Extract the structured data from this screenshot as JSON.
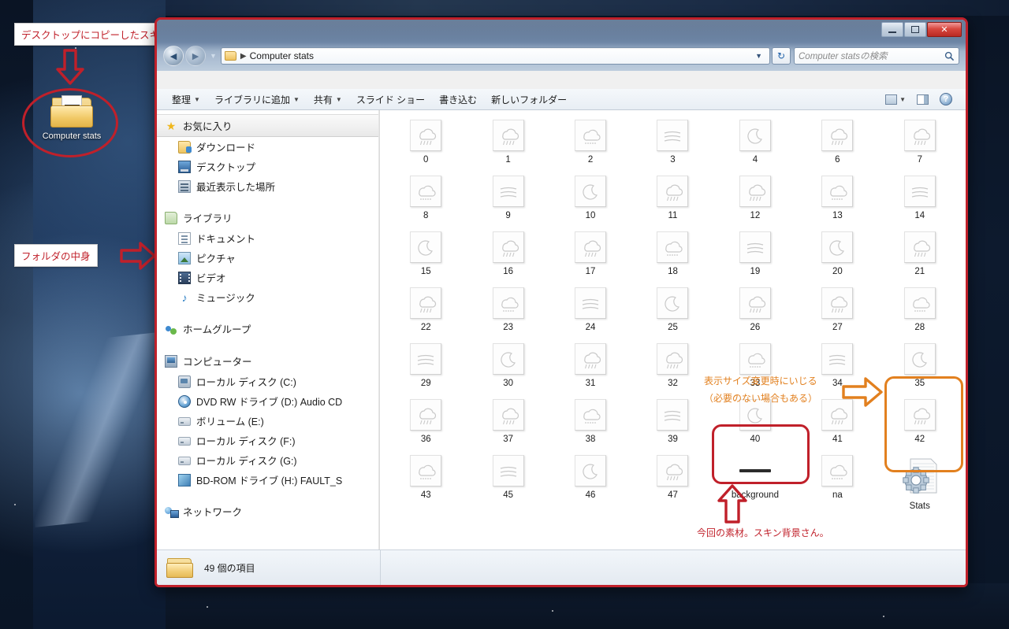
{
  "desktop": {
    "icon_label": "Computer stats",
    "annotations": {
      "callout_top": "デスクトップにコピーしたスキンのフォルダ",
      "callout_left": "フォルダの中身",
      "orange_line1": "表示サイズ変更時にいじる",
      "orange_line2": "（必要のない場合もある）",
      "red_bottom": "今回の素材。スキン背景さん。"
    },
    "colors": {
      "red": "#c0202a",
      "orange": "#e2801f"
    }
  },
  "window": {
    "title_buttons": {
      "minimize": "minimize-button",
      "maximize": "maximize-button",
      "close": "✕"
    },
    "nav": {
      "back": "◄",
      "forward": "►",
      "history_caret": "▼",
      "breadcrumb_root": "",
      "breadcrumb_sep": "▶",
      "breadcrumb_text": "Computer stats",
      "address_caret": "▼",
      "refresh": "↻"
    },
    "search": {
      "placeholder": "Computer statsの検索",
      "icon": "search-icon"
    },
    "toolbar": {
      "items": [
        {
          "label": "整理",
          "caret": "▼"
        },
        {
          "label": "ライブラリに追加",
          "caret": "▼"
        },
        {
          "label": "共有",
          "caret": "▼"
        },
        {
          "label": "スライド ショー",
          "caret": ""
        },
        {
          "label": "書き込む",
          "caret": ""
        },
        {
          "label": "新しいフォルダー",
          "caret": ""
        }
      ],
      "view_caret": "▼",
      "help_glyph": "?"
    }
  },
  "navpane": {
    "sections": [
      {
        "header": {
          "label": "お気に入り",
          "icon": "star-icon",
          "selected": true
        },
        "children": [
          {
            "label": "ダウンロード",
            "icon": "downloads-icon"
          },
          {
            "label": "デスクトップ",
            "icon": "desktop-icon"
          },
          {
            "label": "最近表示した場所",
            "icon": "recent-places-icon"
          }
        ]
      },
      {
        "header": {
          "label": "ライブラリ",
          "icon": "library-icon",
          "selected": false
        },
        "children": [
          {
            "label": "ドキュメント",
            "icon": "documents-icon"
          },
          {
            "label": "ピクチャ",
            "icon": "pictures-icon"
          },
          {
            "label": "ビデオ",
            "icon": "videos-icon"
          },
          {
            "label": "ミュージック",
            "icon": "music-icon"
          }
        ]
      },
      {
        "header": {
          "label": "ホームグループ",
          "icon": "homegroup-icon",
          "selected": false
        },
        "children": []
      },
      {
        "header": {
          "label": "コンピューター",
          "icon": "computer-icon",
          "selected": false
        },
        "children": [
          {
            "label": "ローカル ディスク (C:)",
            "icon": "local-disk-icon"
          },
          {
            "label": "DVD RW ドライブ (D:) Audio CD",
            "icon": "dvd-drive-icon"
          },
          {
            "label": "ボリューム (E:)",
            "icon": "drive-icon"
          },
          {
            "label": "ローカル ディスク (F:)",
            "icon": "drive-icon"
          },
          {
            "label": "ローカル ディスク (G:)",
            "icon": "drive-icon"
          },
          {
            "label": "BD-ROM ドライブ (H:) FAULT_S",
            "icon": "bd-rom-icon"
          }
        ]
      },
      {
        "header": {
          "label": "ネットワーク",
          "icon": "network-icon",
          "selected": false
        },
        "children": []
      }
    ]
  },
  "files": {
    "items": [
      {
        "label": "0",
        "icon": "weather-thumb"
      },
      {
        "label": "1",
        "icon": "weather-thumb"
      },
      {
        "label": "2",
        "icon": "weather-thumb"
      },
      {
        "label": "3",
        "icon": "weather-thumb"
      },
      {
        "label": "4",
        "icon": "weather-thumb"
      },
      {
        "label": "6",
        "icon": "weather-thumb"
      },
      {
        "label": "7",
        "icon": "weather-thumb"
      },
      {
        "label": "8",
        "icon": "weather-thumb"
      },
      {
        "label": "9",
        "icon": "weather-thumb"
      },
      {
        "label": "10",
        "icon": "weather-thumb"
      },
      {
        "label": "11",
        "icon": "weather-thumb"
      },
      {
        "label": "12",
        "icon": "weather-thumb"
      },
      {
        "label": "13",
        "icon": "weather-thumb"
      },
      {
        "label": "14",
        "icon": "weather-thumb"
      },
      {
        "label": "15",
        "icon": "weather-thumb"
      },
      {
        "label": "16",
        "icon": "weather-thumb"
      },
      {
        "label": "17",
        "icon": "weather-thumb"
      },
      {
        "label": "18",
        "icon": "weather-thumb"
      },
      {
        "label": "19",
        "icon": "weather-thumb"
      },
      {
        "label": "20",
        "icon": "weather-thumb"
      },
      {
        "label": "21",
        "icon": "weather-thumb"
      },
      {
        "label": "22",
        "icon": "weather-thumb"
      },
      {
        "label": "23",
        "icon": "weather-thumb"
      },
      {
        "label": "24",
        "icon": "weather-thumb"
      },
      {
        "label": "25",
        "icon": "weather-thumb"
      },
      {
        "label": "26",
        "icon": "weather-thumb"
      },
      {
        "label": "27",
        "icon": "weather-thumb"
      },
      {
        "label": "28",
        "icon": "weather-thumb"
      },
      {
        "label": "29",
        "icon": "weather-thumb"
      },
      {
        "label": "30",
        "icon": "weather-thumb"
      },
      {
        "label": "31",
        "icon": "weather-thumb"
      },
      {
        "label": "32",
        "icon": "weather-thumb"
      },
      {
        "label": "33",
        "icon": "weather-thumb"
      },
      {
        "label": "34",
        "icon": "weather-thumb"
      },
      {
        "label": "35",
        "icon": "weather-thumb"
      },
      {
        "label": "36",
        "icon": "weather-thumb"
      },
      {
        "label": "37",
        "icon": "weather-thumb"
      },
      {
        "label": "38",
        "icon": "weather-thumb"
      },
      {
        "label": "39",
        "icon": "weather-thumb"
      },
      {
        "label": "40",
        "icon": "weather-thumb"
      },
      {
        "label": "41",
        "icon": "weather-thumb"
      },
      {
        "label": "42",
        "icon": "weather-thumb"
      },
      {
        "label": "43",
        "icon": "weather-thumb"
      },
      {
        "label": "45",
        "icon": "weather-thumb"
      },
      {
        "label": "46",
        "icon": "weather-thumb"
      },
      {
        "label": "47",
        "icon": "weather-thumb"
      },
      {
        "label": "background",
        "icon": "background-thumb"
      },
      {
        "label": "na",
        "icon": "weather-thumb"
      },
      {
        "label": "Stats",
        "icon": "stats-ini-icon"
      }
    ]
  },
  "statusbar": {
    "text": "49 個の項目",
    "icon": "folder-icon"
  }
}
